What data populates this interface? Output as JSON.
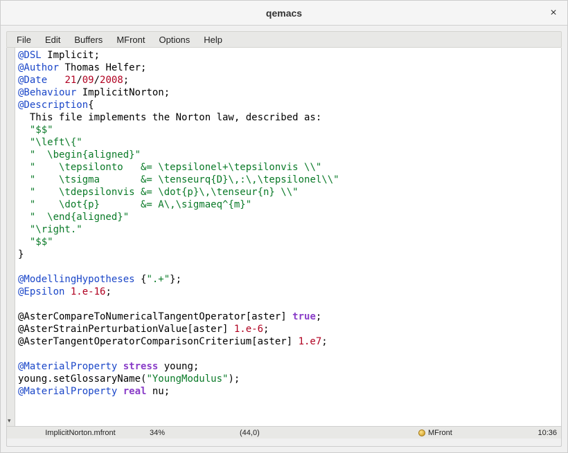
{
  "window": {
    "title": "qemacs"
  },
  "menubar": [
    "File",
    "Edit",
    "Buffers",
    "MFront",
    "Options",
    "Help"
  ],
  "statusbar": {
    "filename": "ImplicitNorton.mfront",
    "percent": "34%",
    "position": "(44,0)",
    "mode": "MFront",
    "time": "10:36"
  },
  "code": {
    "lines": [
      [
        {
          "c": "kw",
          "t": "@DSL"
        },
        {
          "t": " Implicit;"
        }
      ],
      [
        {
          "c": "kw",
          "t": "@Author"
        },
        {
          "t": " Thomas Helfer;"
        }
      ],
      [
        {
          "c": "kw",
          "t": "@Date"
        },
        {
          "t": "   "
        },
        {
          "c": "num",
          "t": "21"
        },
        {
          "t": "/"
        },
        {
          "c": "num",
          "t": "09"
        },
        {
          "t": "/"
        },
        {
          "c": "num",
          "t": "2008"
        },
        {
          "t": ";"
        }
      ],
      [
        {
          "c": "kw",
          "t": "@Behaviour"
        },
        {
          "t": " ImplicitNorton;"
        }
      ],
      [
        {
          "c": "kw",
          "t": "@Description"
        },
        {
          "t": "{"
        }
      ],
      [
        {
          "t": "  This file implements the Norton law, described as:"
        }
      ],
      [
        {
          "t": "  "
        },
        {
          "c": "str",
          "t": "\"$$\""
        }
      ],
      [
        {
          "t": "  "
        },
        {
          "c": "str",
          "t": "\"\\left\\{\""
        }
      ],
      [
        {
          "t": "  "
        },
        {
          "c": "str",
          "t": "\"  \\begin{aligned}\""
        }
      ],
      [
        {
          "t": "  "
        },
        {
          "c": "str",
          "t": "\"    \\tepsilonto   &= \\tepsilonel+\\tepsilonvis \\\\\""
        }
      ],
      [
        {
          "t": "  "
        },
        {
          "c": "str",
          "t": "\"    \\tsigma       &= \\tenseurq{D}\\,:\\,\\tepsilonel\\\\\""
        }
      ],
      [
        {
          "t": "  "
        },
        {
          "c": "str",
          "t": "\"    \\tdepsilonvis &= \\dot{p}\\,\\tenseur{n} \\\\\""
        }
      ],
      [
        {
          "t": "  "
        },
        {
          "c": "str",
          "t": "\"    \\dot{p}       &= A\\,\\sigmaeq^{m}\""
        }
      ],
      [
        {
          "t": "  "
        },
        {
          "c": "str",
          "t": "\"  \\end{aligned}\""
        }
      ],
      [
        {
          "t": "  "
        },
        {
          "c": "str",
          "t": "\"\\right.\""
        }
      ],
      [
        {
          "t": "  "
        },
        {
          "c": "str",
          "t": "\"$$\""
        }
      ],
      [
        {
          "t": "}"
        }
      ],
      [
        {
          "t": ""
        }
      ],
      [
        {
          "c": "kw",
          "t": "@ModellingHypotheses"
        },
        {
          "t": " {"
        },
        {
          "c": "str",
          "t": "\".+\""
        },
        {
          "t": "};"
        }
      ],
      [
        {
          "c": "kw",
          "t": "@Epsilon"
        },
        {
          "t": " "
        },
        {
          "c": "num",
          "t": "1.e-16"
        },
        {
          "t": ";"
        }
      ],
      [
        {
          "t": ""
        }
      ],
      [
        {
          "t": "@AsterCompareToNumericalTangentOperator[aster] "
        },
        {
          "c": "bool",
          "t": "true"
        },
        {
          "t": ";"
        }
      ],
      [
        {
          "t": "@AsterStrainPerturbationValue[aster] "
        },
        {
          "c": "num",
          "t": "1.e-6"
        },
        {
          "t": ";"
        }
      ],
      [
        {
          "t": "@AsterTangentOperatorComparisonCriterium[aster] "
        },
        {
          "c": "num",
          "t": "1.e7"
        },
        {
          "t": ";"
        }
      ],
      [
        {
          "t": ""
        }
      ],
      [
        {
          "c": "kw",
          "t": "@MaterialProperty"
        },
        {
          "t": " "
        },
        {
          "c": "type",
          "t": "stress"
        },
        {
          "t": " young;"
        }
      ],
      [
        {
          "t": "young.setGlossaryName("
        },
        {
          "c": "str",
          "t": "\"YoungModulus\""
        },
        {
          "t": ");"
        }
      ],
      [
        {
          "c": "kw",
          "t": "@MaterialProperty"
        },
        {
          "t": " "
        },
        {
          "c": "type",
          "t": "real"
        },
        {
          "t": " nu;"
        }
      ]
    ]
  }
}
